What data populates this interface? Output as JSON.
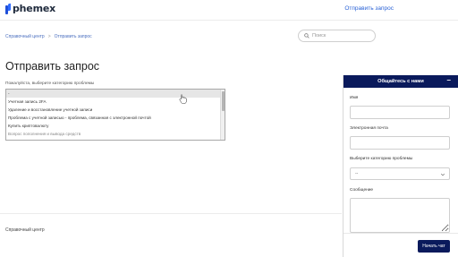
{
  "header": {
    "logo_text": "phemex",
    "submit_request_link": "Отправить запрос"
  },
  "breadcrumb": {
    "items": [
      "Справочный центр",
      "Отправить запрос"
    ],
    "separator": ">"
  },
  "search": {
    "placeholder": "Поиск"
  },
  "page": {
    "title": "Отправить запрос",
    "category_label": "Пожалуйста, выберите категорию проблемы",
    "category_options": [
      "-",
      "Учетная запись 2FA",
      "Удаление и восстановление учетной записи",
      "Проблема с учетной записью - проблема, связанная с электронной почтой",
      "Купить криптовалюту",
      "Вопрос пополнения и вывода средств"
    ],
    "selected_option": "-"
  },
  "footer": {
    "help_center_link": "Справочный центр"
  },
  "chat": {
    "title": "Общайтесь с нами",
    "minimize_glyph": "–",
    "name_label": "Имя",
    "email_label": "Электронная почта",
    "category_label": "Выберите категорию проблемы",
    "category_value": "--",
    "message_label": "Сообщение",
    "start_button": "Начать чат"
  },
  "colors": {
    "brand_blue": "#2a62d6",
    "chat_navy": "#0a1a5c"
  }
}
